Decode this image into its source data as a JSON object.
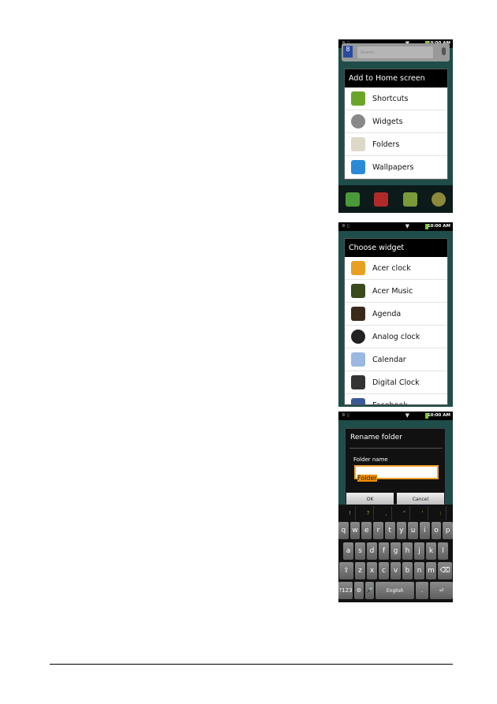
{
  "status_bar": {
    "time": "10:00",
    "ampm": "AM"
  },
  "screen1": {
    "search_placeholder": "Search",
    "title": "Add to Home screen",
    "items": [
      {
        "label": "Shortcuts",
        "icon": "shortcut-arrow-icon",
        "color": "#6aa52a"
      },
      {
        "label": "Widgets",
        "icon": "gear-icon",
        "color": "#888888"
      },
      {
        "label": "Folders",
        "icon": "folder-icon",
        "color": "#ddd8c8"
      },
      {
        "label": "Wallpapers",
        "icon": "wallpaper-icon",
        "color": "#2a8ad8"
      }
    ],
    "dock": [
      "phone-icon",
      "contacts-icon",
      "messaging-icon",
      "browser-icon"
    ]
  },
  "screen2": {
    "title": "Choose widget",
    "items": [
      {
        "label": "Acer clock",
        "icon": "acer-clock-icon",
        "color": "#e8a020"
      },
      {
        "label": "Acer Music",
        "icon": "music-icon",
        "color": "#3a4a1a"
      },
      {
        "label": "Agenda",
        "icon": "agenda-icon",
        "color": "#3a2a1a"
      },
      {
        "label": "Analog clock",
        "icon": "analog-clock-icon",
        "color": "#222222"
      },
      {
        "label": "Calendar",
        "icon": "calendar-icon",
        "color": "#9ab8e0"
      },
      {
        "label": "Digital Clock",
        "icon": "digital-clock-icon",
        "color": "#333333"
      },
      {
        "label": "Facebook",
        "icon": "facebook-icon",
        "color": "#3b5998"
      }
    ]
  },
  "screen3": {
    "title": "Rename folder",
    "field_label": "Folder name",
    "field_value": "Folder",
    "ok": "OK",
    "cancel": "Cancel",
    "symbols": [
      "!",
      "?",
      ",",
      "\"",
      "'",
      ":"
    ],
    "rows": [
      [
        "q",
        "w",
        "e",
        "r",
        "t",
        "y",
        "u",
        "i",
        "o",
        "p"
      ],
      [
        "a",
        "s",
        "d",
        "f",
        "g",
        "h",
        "j",
        "k",
        "l"
      ],
      [
        "⇧",
        "z",
        "x",
        "c",
        "v",
        "b",
        "n",
        "m",
        "⌫"
      ],
      [
        "?123",
        "⚙",
        "🎤",
        "English",
        ".",
        " ⏎"
      ]
    ]
  }
}
